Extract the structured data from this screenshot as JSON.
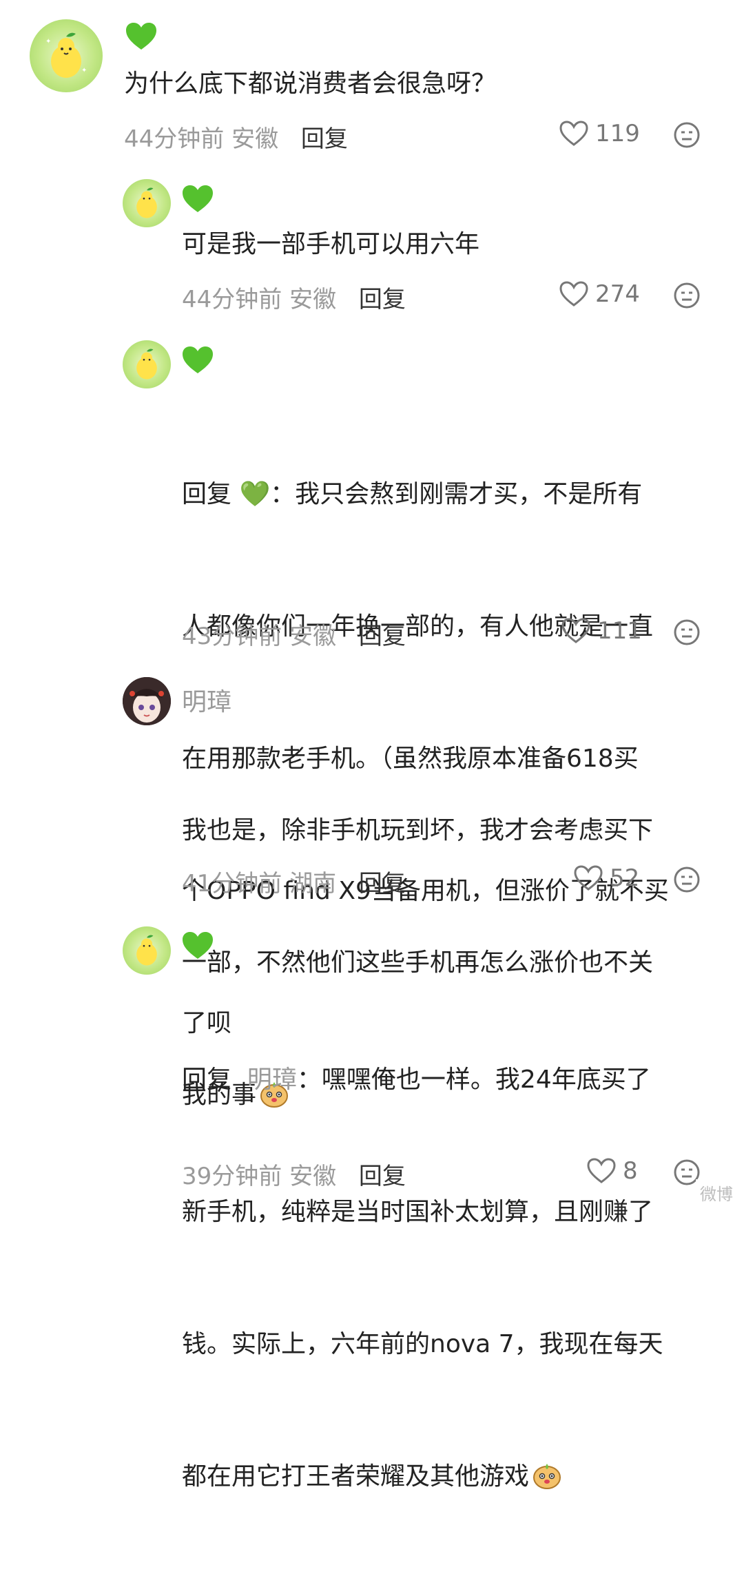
{
  "comments": [
    {
      "badge": "green-heart",
      "text": "为什么底下都说消费者会很急呀？",
      "time": "44分钟前",
      "location": "安徽",
      "reply_label": "回复",
      "likes": "119"
    },
    {
      "badge": "green-heart",
      "text": "可是我一部手机可以用六年",
      "time": "44分钟前",
      "location": "安徽",
      "reply_label": "回复",
      "likes": "274"
    },
    {
      "badge": "green-heart",
      "reply_prefix": "回复",
      "reply_target": "💚",
      "text_lines": [
        "：我只会熬到刚需才买，不是所有",
        "人都像你们一年换一部的，有人他就是一直",
        "在用那款老手机。（虽然我原本准备618买",
        "个OPPO find X9当备用机，但涨价了就不买",
        "了呗"
      ],
      "time": "43分钟前",
      "location": "安徽",
      "reply_label": "回复",
      "likes": "111"
    },
    {
      "name": "明璋",
      "text_lines": [
        "我也是，除非手机玩到坏，我才会考虑买下",
        "一部，不然他们这些手机再怎么涨价也不关",
        "我的事"
      ],
      "time": "41分钟前",
      "location": "湖南",
      "reply_label": "回复",
      "likes": "52"
    },
    {
      "badge": "green-heart",
      "reply_prefix": "回复",
      "reply_target": "明璋",
      "text_lines": [
        "：嘿嘿俺也一样。我24年底买了",
        "新手机，纯粹是当时国补太划算，且刚赚了",
        "钱。实际上，六年前的nova 7，我现在每天",
        "都在用它打王者荣耀及其他游戏"
      ],
      "time": "39分钟前",
      "location": "安徽",
      "reply_label": "回复",
      "likes": "8"
    }
  ],
  "watermark": "微博",
  "colors": {
    "badge_green": "#55c12e",
    "meta_gray": "#9a9a9a"
  }
}
